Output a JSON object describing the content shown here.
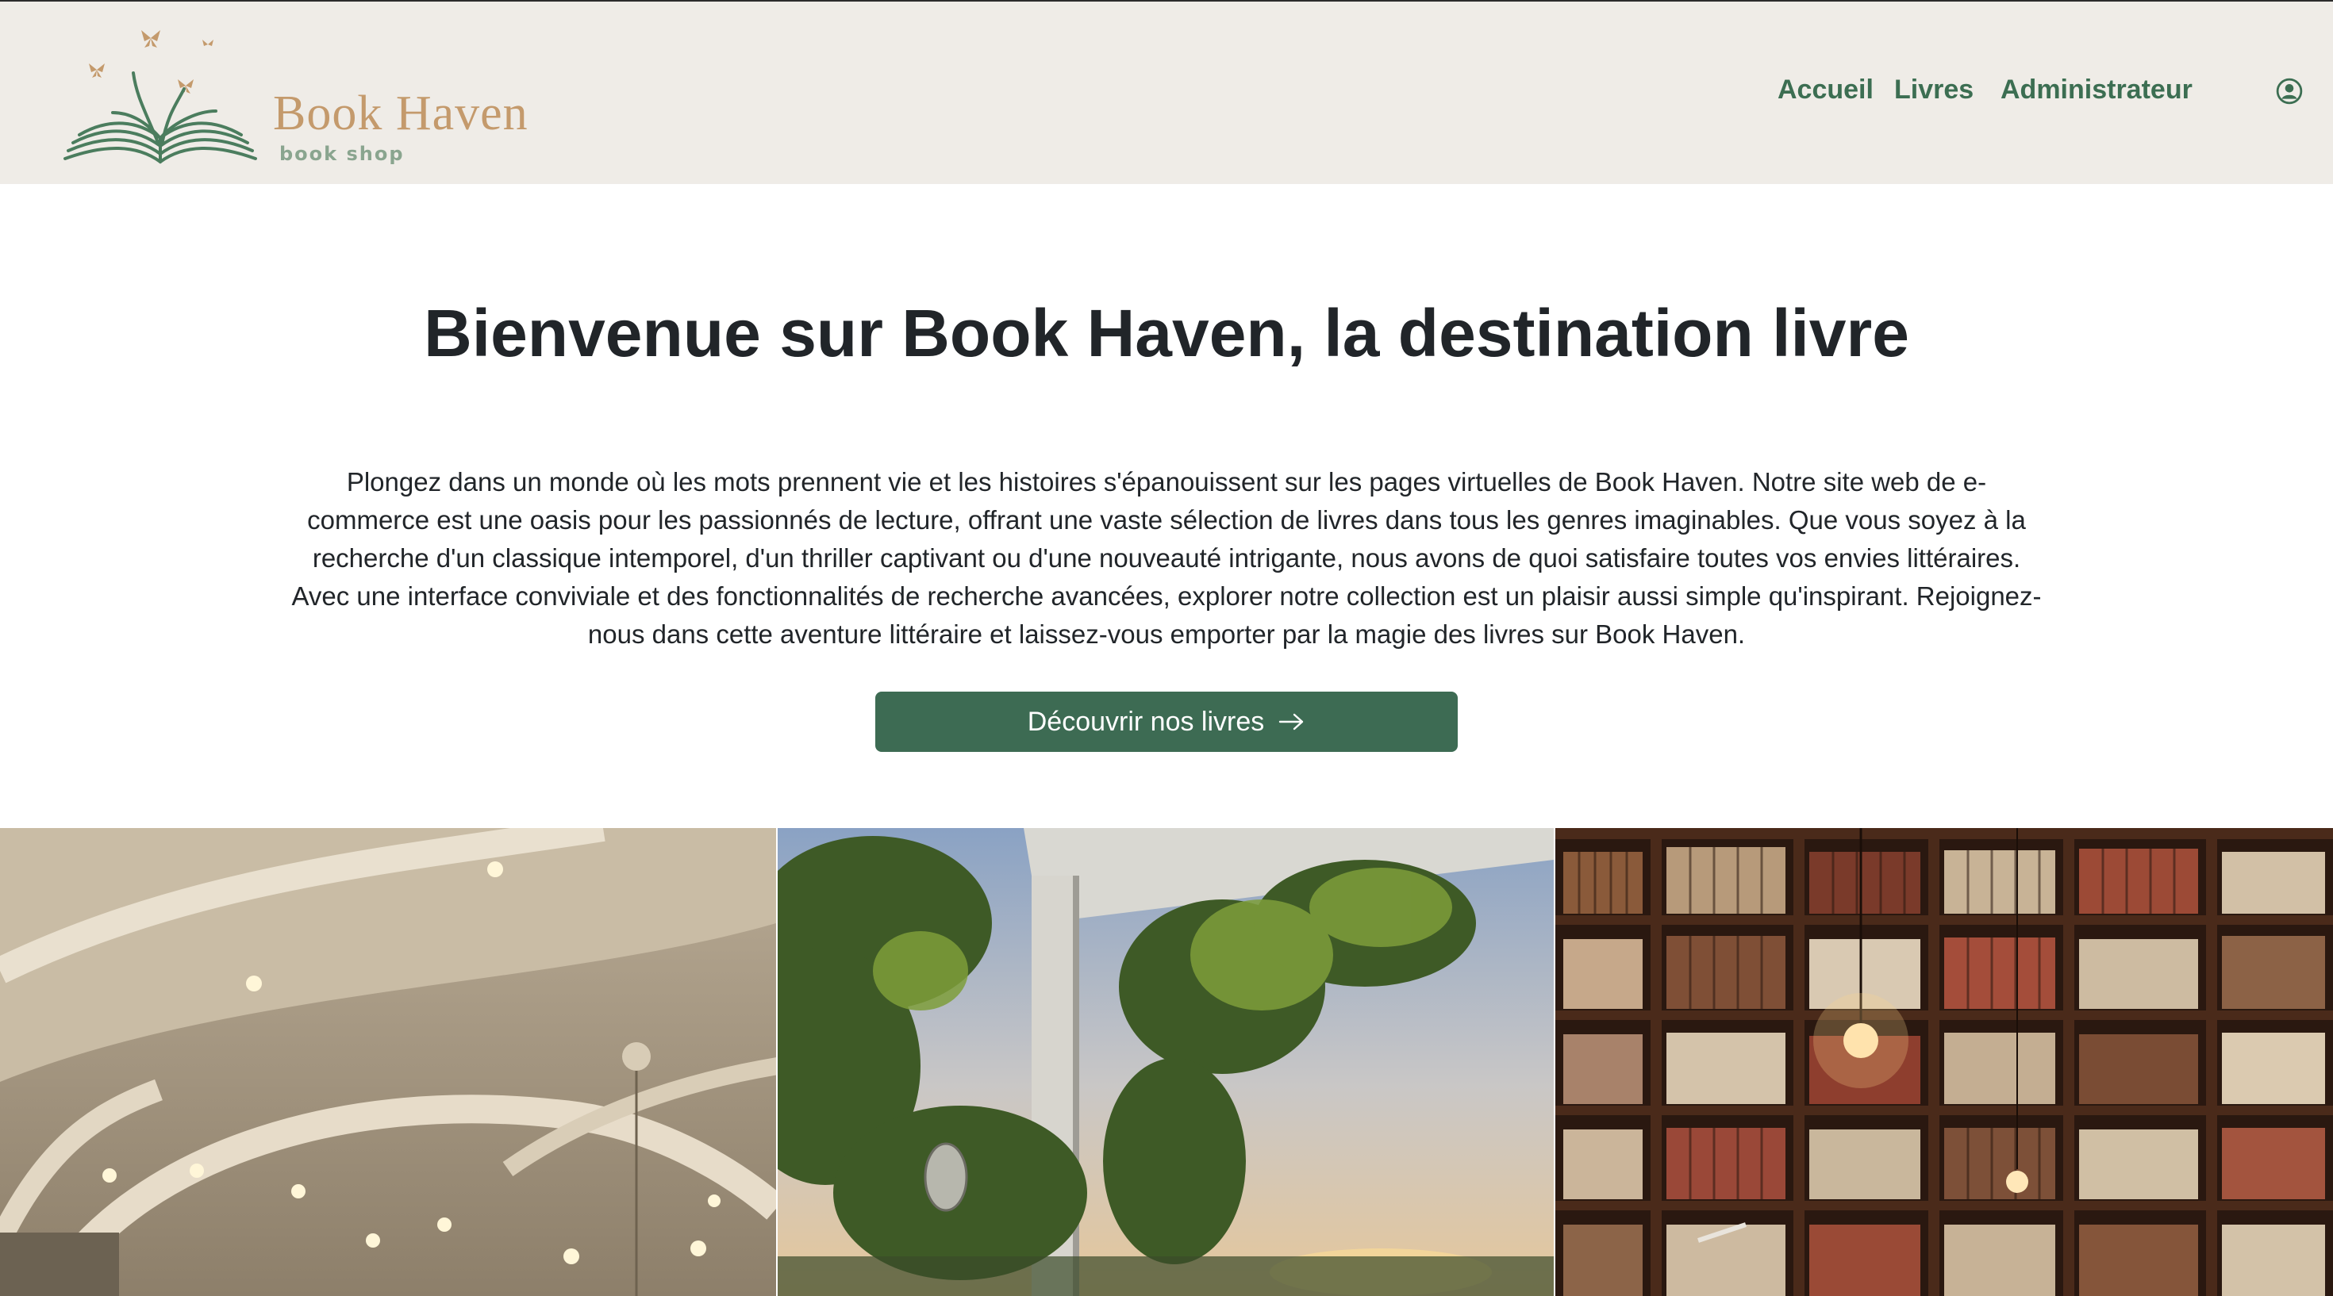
{
  "brand": {
    "name": "Book Haven",
    "tagline": "book shop",
    "colors": {
      "brand_green": "#3c6e52",
      "gold": "#c49a6c",
      "header_bg": "#efece7"
    }
  },
  "nav": {
    "items": [
      {
        "label": "Accueil"
      },
      {
        "label": "Livres"
      },
      {
        "label": "Administrateur"
      }
    ],
    "account_icon": "user-circle-icon"
  },
  "hero": {
    "title": "Bienvenue sur Book Haven, la destination livre",
    "paragraph": "Plongez dans un monde où les mots prennent vie et les histoires s'épanouissent sur les pages virtuelles de Book Haven. Notre site web de e-commerce est une oasis pour les passionnés de lecture, offrant une vaste sélection de livres dans tous les genres imaginables. Que vous soyez à la recherche d'un classique intemporel, d'un thriller captivant ou d'une nouveauté intrigante, nous avons de quoi satisfaire toutes vos envies littéraires. Avec une interface conviviale et des fonctionnalités de recherche avancées, explorer notre collection est un plaisir aussi simple qu'inspirant. Rejoignez-nous dans cette aventure littéraire et laissez-vous emporter par la magie des livres sur Book Haven.",
    "cta_label": "Découvrir nos livres",
    "cta_icon": "arrow-right-icon"
  }
}
